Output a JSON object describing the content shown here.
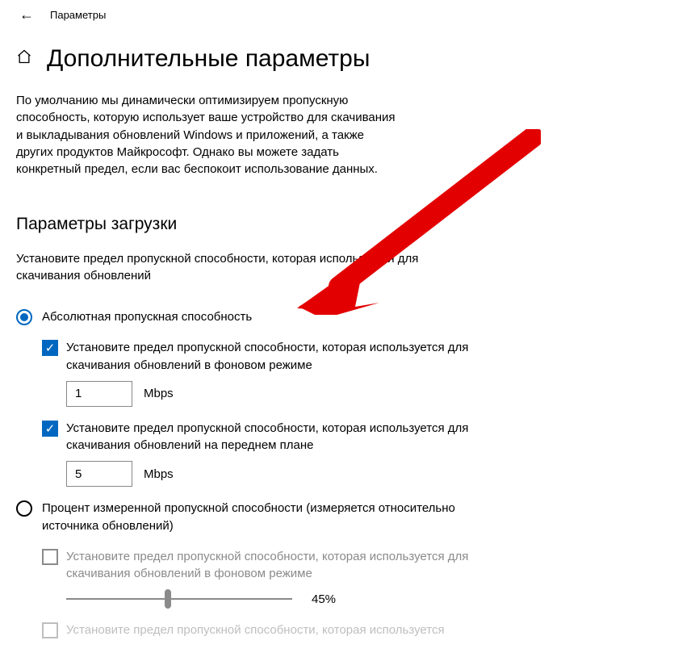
{
  "titlebar": {
    "app_name": "Параметры"
  },
  "header": {
    "title": "Дополнительные параметры"
  },
  "intro": "По умолчанию мы динамически оптимизируем пропускную способность, которую использует ваше устройство для скачивания и выкладывания обновлений Windows и приложений, а также других продуктов Майкрософт. Однако вы можете задать конкретный предел, если вас беспокоит использование данных.",
  "download": {
    "section_title": "Параметры загрузки",
    "section_sub": "Установите предел пропускной способности, которая используется для скачивания обновлений",
    "radio_abs": "Абсолютная пропускная способность",
    "abs_bg_check": "Установите предел пропускной способности, которая используется для скачивания обновлений в фоновом режиме",
    "abs_bg_value": "1",
    "abs_fg_check": "Установите предел пропускной способности, которая используется для скачивания обновлений на переднем плане",
    "abs_fg_value": "5",
    "unit": "Mbps",
    "radio_pct": "Процент измеренной пропускной способности (измеряется относительно источника обновлений)",
    "pct_bg_check": "Установите предел пропускной способности, которая используется для скачивания обновлений в фоновом режиме",
    "pct_bg_value": "45%",
    "pct_fg_check_trunc": "Установите предел пропускной способности, которая используется"
  }
}
